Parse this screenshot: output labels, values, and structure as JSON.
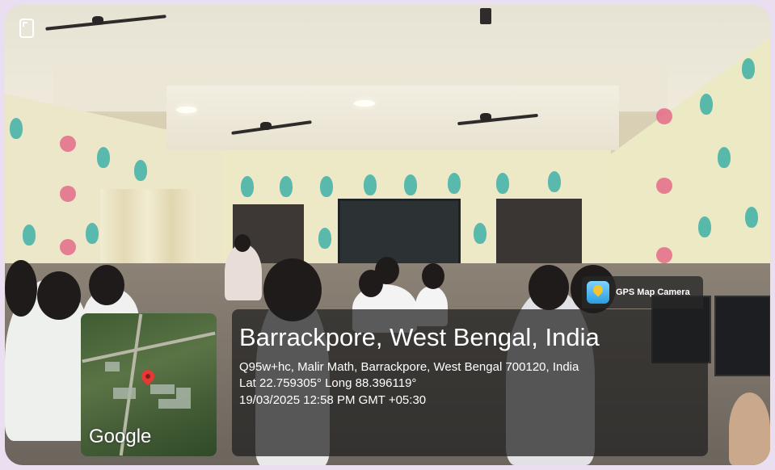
{
  "overlay": {
    "brand_label": "GPS Map Camera",
    "place_title": "Barrackpore, West Bengal, India",
    "address": "Q95w+hc, Malir Math, Barrackpore, West Bengal 700120, India",
    "coordinates": "Lat 22.759305° Long 88.396119°",
    "timestamp": "19/03/2025 12:58 PM GMT +05:30",
    "map_provider": "Google"
  },
  "colors": {
    "wall": "#ede9c6",
    "motif_teal": "#3eb0a7",
    "motif_pink": "#e56b8a",
    "pin": "#e53935"
  },
  "icons": [
    "corner-frame-icon",
    "gps-map-camera-logo-icon",
    "map-pin-icon"
  ]
}
